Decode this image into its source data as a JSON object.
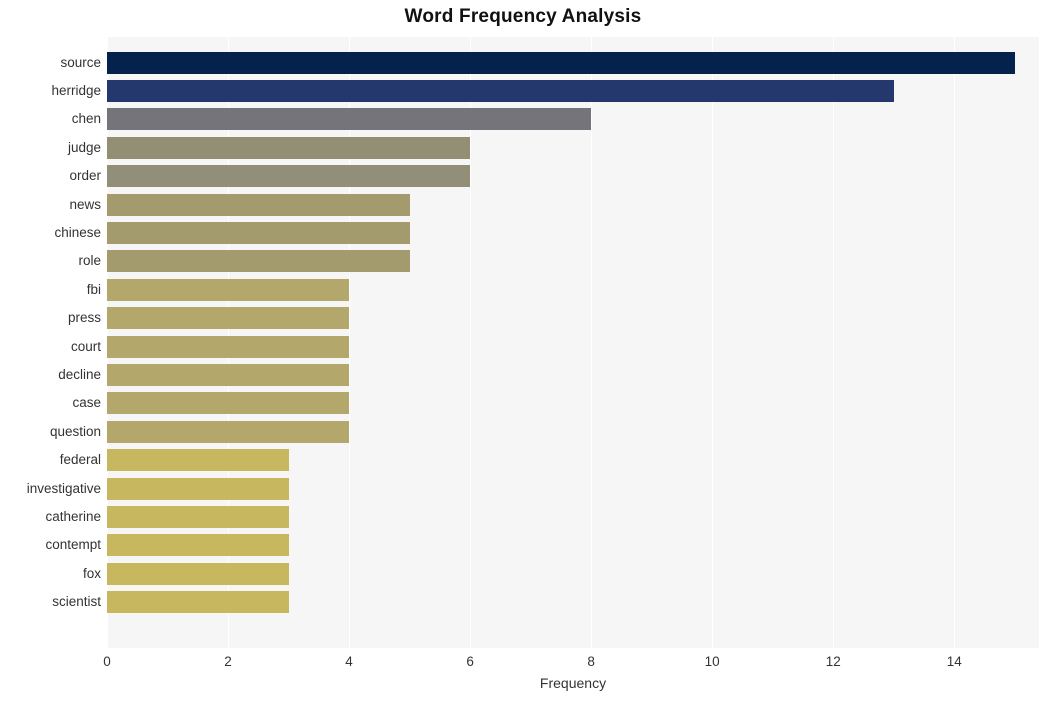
{
  "chart_data": {
    "type": "bar",
    "orientation": "horizontal",
    "title": "Word Frequency Analysis",
    "xlabel": "Frequency",
    "ylabel": "",
    "xlim": [
      0,
      15.4
    ],
    "ylim": null,
    "grid": true,
    "legend": null,
    "xticks": [
      "0",
      "2",
      "4",
      "6",
      "8",
      "10",
      "12",
      "14"
    ],
    "xtick_values": [
      0,
      2,
      4,
      6,
      8,
      10,
      12,
      14
    ],
    "categories": [
      "source",
      "herridge",
      "chen",
      "judge",
      "order",
      "news",
      "chinese",
      "role",
      "fbi",
      "press",
      "court",
      "decline",
      "case",
      "question",
      "federal",
      "investigative",
      "catherine",
      "contempt",
      "fox",
      "scientist"
    ],
    "values": [
      15,
      13,
      8,
      6,
      6,
      5,
      5,
      5,
      4,
      4,
      4,
      4,
      4,
      4,
      3,
      3,
      3,
      3,
      3,
      3
    ],
    "bar_colors": [
      "#04224c",
      "#25386e",
      "#74747a",
      "#938f75",
      "#928e77",
      "#a39b6d",
      "#a39b6d",
      "#a39b6d",
      "#b4a76c",
      "#b4a76c",
      "#b4a76c",
      "#b4a76c",
      "#b4a76c",
      "#b4a76c",
      "#c7b860",
      "#c7b860",
      "#c7b860",
      "#c7b860",
      "#c7b860",
      "#c7b860"
    ],
    "plot_background": "#f6f6f6",
    "gridline_color": "#ffffff",
    "figure_background": "#ffffff",
    "text_color": "#333333",
    "title_color": "#111111"
  }
}
